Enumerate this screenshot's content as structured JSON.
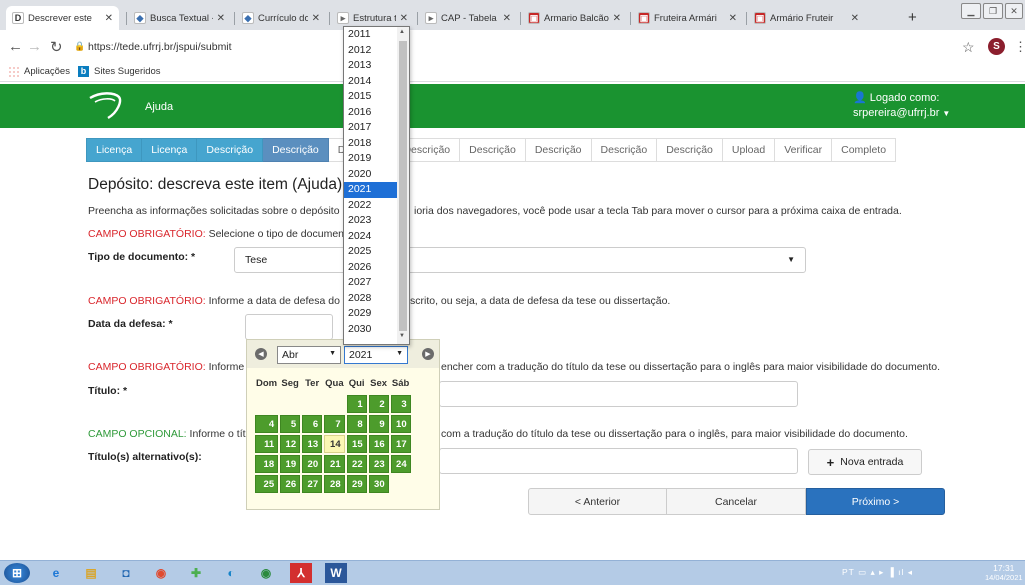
{
  "browser": {
    "tabs": [
      {
        "title": "Descrever este",
        "icon": "dspace-icon",
        "active": true
      },
      {
        "title": "Busca Textual -",
        "icon": "cnpq-icon"
      },
      {
        "title": "Currículo do Sis",
        "icon": "cnpq-icon"
      },
      {
        "title": "Estrutura tarifá",
        "icon": "page-icon"
      },
      {
        "title": "CAP - Tabela Ta",
        "icon": "page-icon"
      },
      {
        "title": "Armario Balcão",
        "icon": "store-icon"
      },
      {
        "title": "Fruteira Armári",
        "icon": "store-icon"
      },
      {
        "title": "Armário Fruteir",
        "icon": "store-icon"
      }
    ],
    "close_glyph": "✕",
    "new_tab": "+",
    "url": "https://tede.ufrrj.br/jspui/submit",
    "profile_initial": "S",
    "bookmarks": [
      {
        "label": "Aplicações"
      },
      {
        "label": "Sites Sugeridos"
      }
    ]
  },
  "site": {
    "help_label": "Ajuda",
    "logged_as_label": "Logado como:",
    "user_email": "srpereira@ufrrj.br",
    "header_color": "#1a9330"
  },
  "steps": [
    {
      "label": "Licença",
      "state": "done"
    },
    {
      "label": "Licença",
      "state": "done"
    },
    {
      "label": "Descrição",
      "state": "done"
    },
    {
      "label": "Descrição",
      "state": "current"
    },
    {
      "label": "Descrição",
      "state": "todo"
    },
    {
      "label": "Descrição",
      "state": "todo"
    },
    {
      "label": "Descrição",
      "state": "todo"
    },
    {
      "label": "Descrição",
      "state": "todo"
    },
    {
      "label": "Descrição",
      "state": "todo"
    },
    {
      "label": "Descrição",
      "state": "todo"
    },
    {
      "label": "Upload",
      "state": "todo"
    },
    {
      "label": "Verificar",
      "state": "todo"
    },
    {
      "label": "Completo",
      "state": "todo"
    }
  ],
  "form": {
    "title": "Depósito: descreva este item (Ajuda)",
    "intro_a": "Preencha as informações solicitadas sobre o depósito",
    "intro_b": "ioria dos navegadores, você pode usar a tecla Tab para mover o cursor para a próxima caixa de entrada.",
    "req_tag": "CAMPO OBRIGATÓRIO:",
    "opt_tag": "CAMPO OPCIONAL:",
    "doc_type_hint": "Selecione o tipo de documen",
    "doc_type_label": "Tipo de documento: *",
    "doc_type_value": "Tese",
    "date_hint_a": "Informe a data de defesa do",
    "date_hint_b": "scrito, ou seja, a data de defesa da tese ou dissertação.",
    "date_label": "Data da defesa: *",
    "title_hint_a": "Informe",
    "title_hint_b": "encher com a tradução do título da tese ou dissertação para o inglês para maior visibilidade do documento.",
    "title_label": "Título: *",
    "alt_title_hint_a": "Informe o tít",
    "alt_title_hint_b": "com a tradução do título da tese ou dissertação para o inglês, para maior visibilidade do documento.",
    "alt_title_label": "Título(s) alternativo(s):",
    "add_entry": "Nova entrada",
    "btn_prev": "< Anterior",
    "btn_cancel": "Cancelar",
    "btn_next": "Próximo >"
  },
  "datepicker": {
    "month": "Abr",
    "year": "2021",
    "weekdays": [
      "Dom",
      "Seg",
      "Ter",
      "Qua",
      "Qui",
      "Sex",
      "Sáb"
    ],
    "weeks": [
      [
        "",
        "",
        "",
        "",
        "1",
        "2",
        "3"
      ],
      [
        "4",
        "5",
        "6",
        "7",
        "8",
        "9",
        "10"
      ],
      [
        "11",
        "12",
        "13",
        "14",
        "15",
        "16",
        "17"
      ],
      [
        "18",
        "19",
        "20",
        "21",
        "22",
        "23",
        "24"
      ],
      [
        "25",
        "26",
        "27",
        "28",
        "29",
        "30",
        ""
      ]
    ],
    "today": "14",
    "years": [
      "2011",
      "2012",
      "2013",
      "2014",
      "2015",
      "2016",
      "2017",
      "2018",
      "2019",
      "2020",
      "2021",
      "2022",
      "2023",
      "2024",
      "2025",
      "2026",
      "2027",
      "2028",
      "2029",
      "2030"
    ],
    "selected_year": "2021"
  },
  "taskbar": {
    "tray_lang": "PT",
    "time": "17:31",
    "date": "14/04/2021"
  }
}
